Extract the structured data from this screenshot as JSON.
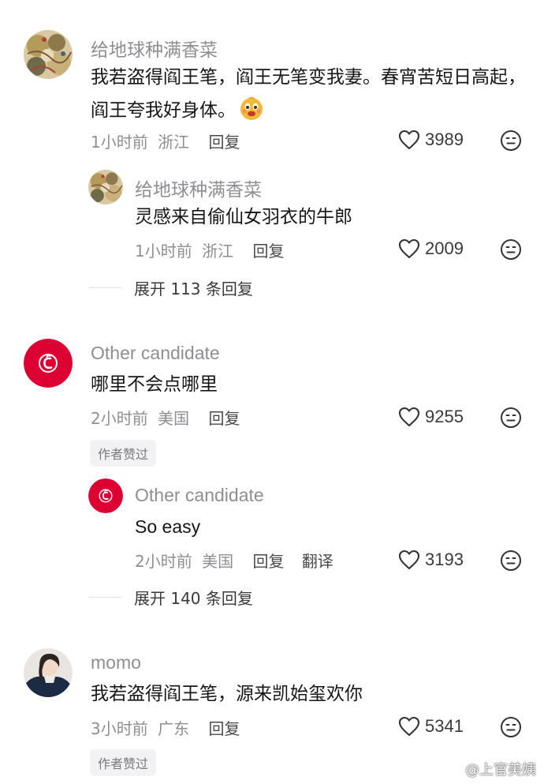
{
  "comments": [
    {
      "username": "给地球种满香菜",
      "content": "我若盗得阎王笔，阎王无笔变我妻。春宵苦短日高起，阎王夸我好身体。",
      "time": "1小时前",
      "location": "浙江",
      "reply_label": "回复",
      "likes": "3989",
      "replies": [
        {
          "username": "给地球种满香菜",
          "content": "灵感来自偷仙女羽衣的牛郎",
          "time": "1小时前",
          "location": "浙江",
          "reply_label": "回复",
          "likes": "2009"
        }
      ],
      "expand_label": "展开 113 条回复"
    },
    {
      "username": "Other candidate",
      "content": "哪里不会点哪里",
      "time": "2小时前",
      "location": "美国",
      "reply_label": "回复",
      "likes": "9255",
      "badge": "作者赞过",
      "replies": [
        {
          "username": "Other candidate",
          "content": "So easy",
          "time": "2小时前",
          "location": "美国",
          "reply_label": "回复",
          "translate_label": "翻译",
          "likes": "3193"
        }
      ],
      "expand_label": "展开 140 条回复"
    },
    {
      "username": "momo",
      "content": "我若盗得阎王笔，源来凯始玺欢你",
      "time": "3小时前",
      "location": "广东",
      "reply_label": "回复",
      "likes": "5341",
      "badge": "作者赞过"
    }
  ],
  "watermark": "@上官美姨",
  "icons": {
    "like": "heart-outline-icon",
    "dislike": "neutral-face-icon",
    "emoji": "grinning-face-emoji",
    "avatar_brand": "chick-fil-a-logo"
  },
  "colors": {
    "username": "#8e8e93",
    "text": "#161616",
    "meta": "#8e8e93",
    "brand_red": "#dd0033",
    "badge_bg": "#f2f2f4"
  }
}
